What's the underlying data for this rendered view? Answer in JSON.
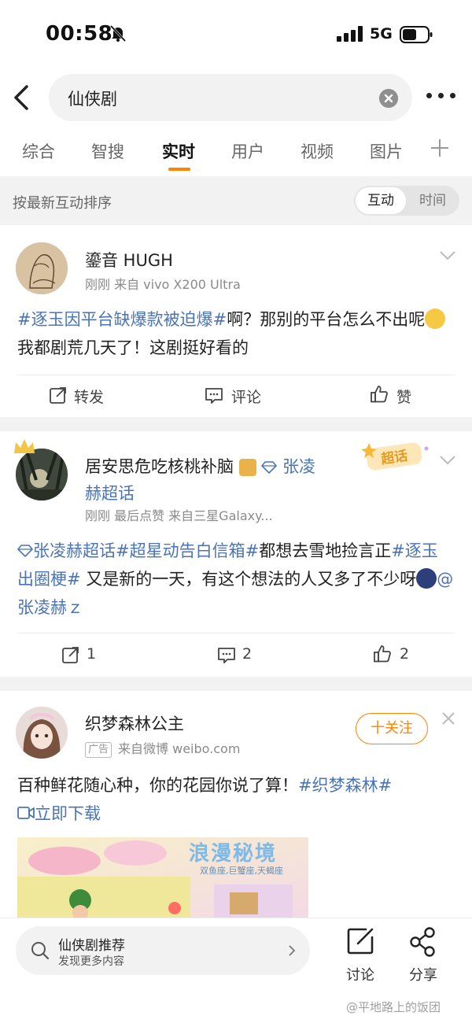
{
  "status": {
    "time": "00:58",
    "network": "5G"
  },
  "search": {
    "query": "仙侠剧"
  },
  "tabs": [
    {
      "label": "综合"
    },
    {
      "label": "智搜"
    },
    {
      "label": "实时"
    },
    {
      "label": "用户"
    },
    {
      "label": "视频"
    },
    {
      "label": "图片"
    }
  ],
  "sort": {
    "label": "按最新互动排序",
    "option_active": "互动",
    "option_inactive": "时间"
  },
  "posts": [
    {
      "username": "鎏音 HUGH",
      "meta": "刚刚 来自 vivo X200 Ultra",
      "hashtag": "#逐玉因平台缺爆款被迫爆#",
      "text_a": "啊？那别的平台怎么不出呢",
      "text_b": "我都剧荒几天了！这剧挺好看的",
      "repost": "转发",
      "comment": "评论",
      "like": "赞"
    },
    {
      "username_a": "居安思危吃核桃补脑",
      "username_link": "张凌赫超话",
      "meta": "刚刚  最后点赞  来自三星Galaxy...",
      "badge": "超话",
      "tag_super": "张凌赫超话",
      "tag_event": "#超星动告白信箱#",
      "text_a": "都想去雪地捡言正",
      "tag_meme": "#逐玉 出圈梗#",
      "text_b": " 又是新的一天，有这个想法的人又多了不少呀",
      "mention": "@张凌赫ｚ",
      "repost": "1",
      "comment": "2",
      "like": "2"
    },
    {
      "username": "织梦森林公主",
      "ad_tag": "广告",
      "meta": "来自微博 weibo.com",
      "follow": "十关注",
      "text_a": "百种鲜花随心种，你的花园你说了算！",
      "hashtag": "#织梦森林#",
      "download": "立即下载",
      "ad_image_title": "浪漫秘境",
      "ad_image_sub": "双鱼座,巨蟹座,天蝎座"
    }
  ],
  "bottom": {
    "rec_title": "仙侠剧推荐",
    "rec_sub": "发现更多内容",
    "discuss": "讨论",
    "share": "分享",
    "watermark": "@平地路上的饭团"
  },
  "colors": {
    "accent": "#ff8200",
    "link": "#4a74b6",
    "band": "#f2f2f2"
  }
}
